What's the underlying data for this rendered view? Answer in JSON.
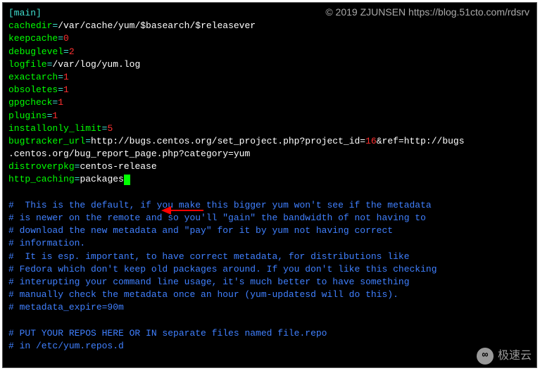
{
  "watermark": "© 2019 ZJUNSEN https://blog.51cto.com/rdsrv",
  "section": "[main]",
  "config": {
    "cachedir": {
      "key": "cachedir",
      "eq": "=",
      "value": "/var/cache/yum/$basearch/$releasever"
    },
    "keepcache": {
      "key": "keepcache",
      "eq": "=",
      "value": "0"
    },
    "debuglevel": {
      "key": "debuglevel",
      "eq": "=",
      "value": "2"
    },
    "logfile": {
      "key": "logfile",
      "eq": "=",
      "value": "/var/log/yum.log"
    },
    "exactarch": {
      "key": "exactarch",
      "eq": "=",
      "value": "1"
    },
    "obsoletes": {
      "key": "obsoletes",
      "eq": "=",
      "value": "1"
    },
    "gpgcheck": {
      "key": "gpgcheck",
      "eq": "=",
      "value": "1"
    },
    "plugins": {
      "key": "plugins",
      "eq": "=",
      "value": "1"
    },
    "installonly_limit": {
      "key": "installonly_limit",
      "eq": "=",
      "value": "5"
    },
    "bugtracker_url": {
      "key": "bugtracker_url",
      "eq": "=",
      "pre": "http://bugs.centos.org/set_project.php?project_id=",
      "id": "16",
      "post": "&ref=http://bugs",
      "line2": ".centos.org/bug_report_page.php?category=yum"
    },
    "distroverpkg": {
      "key": "distroverpkg",
      "eq": "=",
      "value": "centos-release"
    },
    "http_caching": {
      "key": "http_caching",
      "eq": "=",
      "value": "packages"
    }
  },
  "comments": {
    "c1": "#  This is the default, if you make this bigger yum won't see if the metadata",
    "c2": "# is newer on the remote and so you'll \"gain\" the bandwidth of not having to",
    "c3": "# download the new metadata and \"pay\" for it by yum not having correct",
    "c4": "# information.",
    "c5": "#  It is esp. important, to have correct metadata, for distributions like",
    "c6": "# Fedora which don't keep old packages around. If you don't like this checking",
    "c7": "# interupting your command line usage, it's much better to have something",
    "c8": "# manually check the metadata once an hour (yum-updatesd will do this).",
    "c9": "# metadata_expire=90m",
    "c10": "# PUT YOUR REPOS HERE OR IN separate files named file.repo",
    "c11": "# in /etc/yum.repos.d"
  },
  "logo": "极速云"
}
